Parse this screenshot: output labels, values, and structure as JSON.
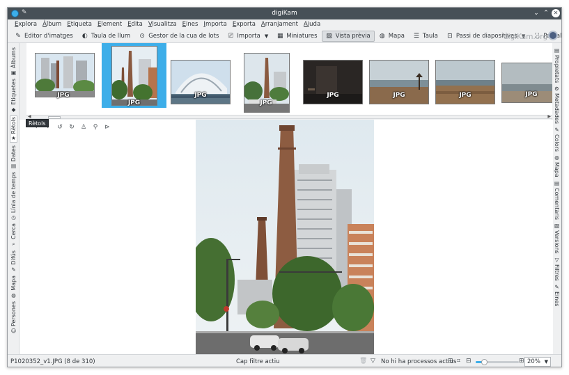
{
  "window": {
    "title": "digiKam"
  },
  "menu": [
    "Explora",
    "Àlbum",
    "Etiqueta",
    "Element",
    "Edita",
    "Visualitza",
    "Eines",
    "Importa",
    "Exporta",
    "Arranjament",
    "Ajuda"
  ],
  "toolbar": {
    "items": [
      {
        "label": "Editor d'imatges",
        "icon": "pencil-icon"
      },
      {
        "label": "Taula de llum",
        "icon": "lighttable-icon"
      },
      {
        "label": "Gestor de la cua de lots",
        "icon": "queue-icon"
      },
      {
        "label": "Importa",
        "icon": "import-icon",
        "dropdown": true
      },
      {
        "label": "Miniatures",
        "icon": "thumbnails-icon"
      },
      {
        "label": "Vista prèvia",
        "icon": "preview-icon",
        "active": true
      },
      {
        "label": "Mapa",
        "icon": "globe-icon"
      },
      {
        "label": "Taula",
        "icon": "table-icon"
      },
      {
        "label": "Passi de diapositives",
        "icon": "slideshow-icon",
        "dropdown": true
      },
      {
        "label": "Pantalla completa",
        "icon": "fullscreen-icon"
      }
    ],
    "brand": "digiKam.org"
  },
  "left_tabs": [
    {
      "label": "Àlbums",
      "icon": "album-icon"
    },
    {
      "label": "Etiquetes",
      "icon": "tag-icon"
    },
    {
      "label": "Rètols",
      "icon": "label-icon",
      "active": true
    },
    {
      "label": "Dates",
      "icon": "calendar-icon"
    },
    {
      "label": "Línia de temps",
      "icon": "timeline-icon"
    },
    {
      "label": "Cerca",
      "icon": "search-icon"
    },
    {
      "label": "Difús",
      "icon": "fuzzy-icon"
    },
    {
      "label": "Mapa",
      "icon": "globe-icon"
    },
    {
      "label": "Persones",
      "icon": "people-icon"
    }
  ],
  "right_tabs": [
    {
      "label": "Propietats",
      "icon": "properties-icon"
    },
    {
      "label": "Metadades",
      "icon": "metadata-icon"
    },
    {
      "label": "Colors",
      "icon": "colors-icon"
    },
    {
      "label": "Mapa",
      "icon": "globe-icon"
    },
    {
      "label": "Comentaris",
      "icon": "comment-icon"
    },
    {
      "label": "Versions",
      "icon": "versions-icon"
    },
    {
      "label": "Filtres",
      "icon": "filter-icon"
    },
    {
      "label": "Eines",
      "icon": "tools-icon"
    }
  ],
  "tooltip": "Rètols",
  "thumbnails": [
    {
      "badge": "JPG",
      "scene": "city"
    },
    {
      "badge": "JPG",
      "scene": "chimney",
      "selected": true
    },
    {
      "badge": "JPG",
      "scene": "arch"
    },
    {
      "badge": "JPG",
      "scene": "chimney2"
    },
    {
      "badge": "JPG",
      "scene": "dark"
    },
    {
      "badge": "JPG",
      "scene": "beach"
    },
    {
      "badge": "JPG",
      "scene": "beach2"
    },
    {
      "badge": "JPG",
      "scene": "sea"
    }
  ],
  "preview_tools": [
    "back-icon",
    "forward-icon",
    "rotate-left-icon",
    "rotate-right-icon",
    "person-icon",
    "add-person-icon",
    "play-icon"
  ],
  "status": {
    "file": "P1020352_v1.JPG (8 de 310)",
    "filter": "Cap filtre actiu",
    "processes": "No hi ha processos actius",
    "zoom": "20%",
    "zoom_level": 0.2
  },
  "colors": {
    "accent": "#3daee9",
    "titlebar": "#475057",
    "window_bg": "#eff0f1"
  }
}
